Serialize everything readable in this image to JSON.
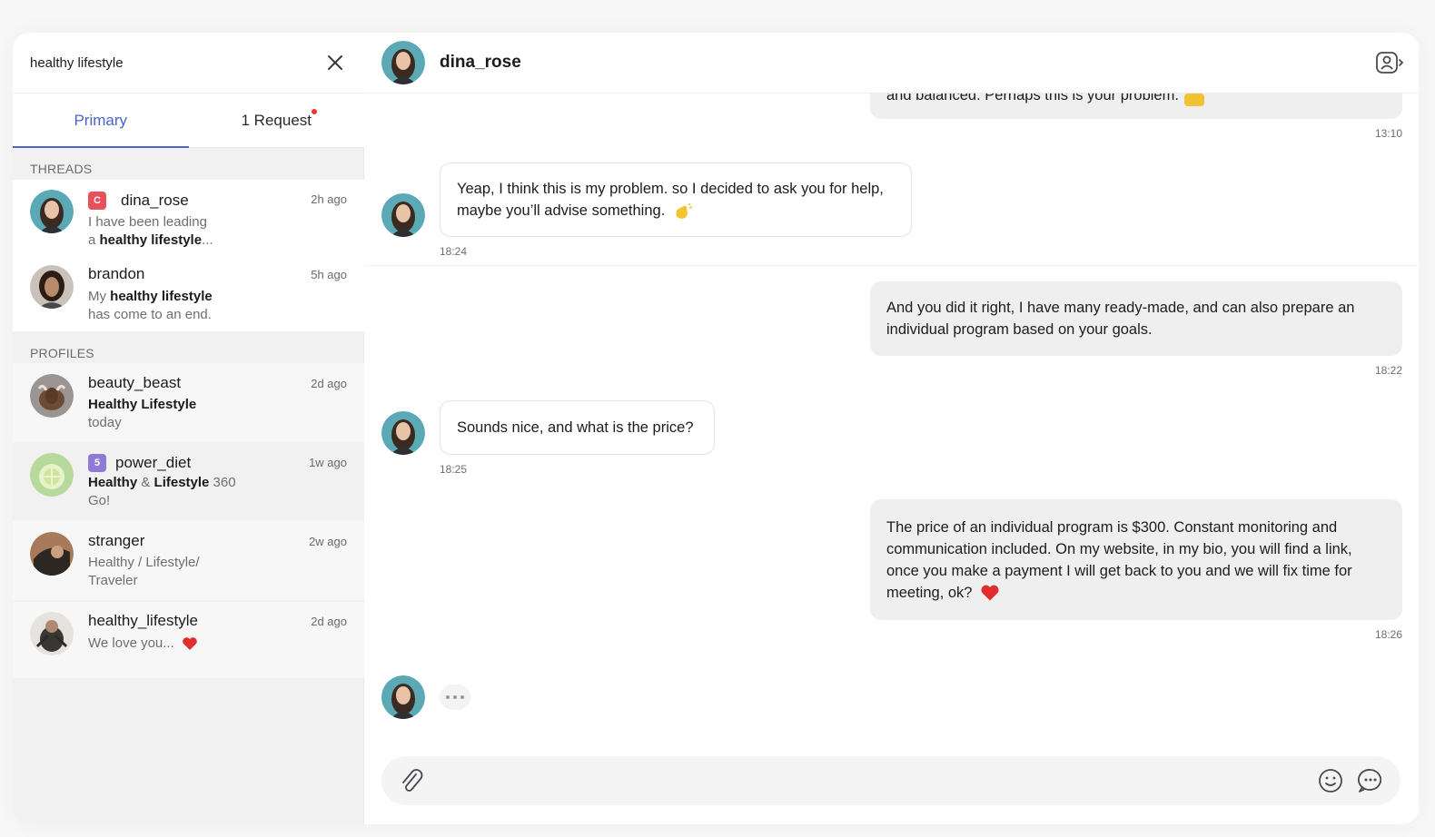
{
  "search": {
    "value": "healthy lifestyle",
    "placeholder": ""
  },
  "tabs": [
    {
      "label": "Primary",
      "active": true
    },
    {
      "label": "1 Request",
      "has_dot": true
    }
  ],
  "sections": {
    "threads": "THREADS",
    "profiles": "PROFILES"
  },
  "threads": [
    {
      "name": "dina_rose",
      "badge": "C",
      "badge_color": "#e8505b",
      "time": "2h ago",
      "line1": "I have been leading",
      "line2_pre": "a ",
      "line2_bold": "healthy lifestyle",
      "line2_post": "..."
    },
    {
      "name": "brandon",
      "time": "5h ago",
      "line1_pre": "My ",
      "line1_bold": "healthy lifestyle",
      "line2": "has come to an end."
    }
  ],
  "profiles": [
    {
      "name": "beauty_beast",
      "time": "2d ago",
      "line1_bold": "Healthy Lifestyle",
      "line2": "today"
    },
    {
      "name": "power_diet",
      "badge": "5",
      "badge_color": "#8f7bd6",
      "time": "1w ago",
      "line1_bold_a": "Healthy",
      "line1_mid": " & ",
      "line1_bold_b": "Lifestyle",
      "line1_post": " 360",
      "line2": "Go!"
    },
    {
      "name": "stranger",
      "time": "2w ago",
      "line1": "Healthy / Lifestyle/",
      "line2": "Traveler"
    },
    {
      "name": "healthy_lifestyle",
      "time": "2d ago",
      "line1": "We love you...",
      "icon": "heart-icon"
    }
  ],
  "chat": {
    "contact_name": "dina_rose",
    "partial_message": "and balanced. Perhaps this is your problem.",
    "partial_time": "13:10",
    "messages": [
      {
        "dir": "in",
        "text1": "Yeap, I think this is my problem. so I decided to ask you for help,",
        "text2": "maybe you’ll advise something.",
        "emoji": "waving-hand-icon",
        "time": "18:24"
      },
      {
        "dir": "out",
        "text1": "And you did it right, I have many ready-made, and can also prepare an",
        "text2": "individual program based on your goals.",
        "time": "18:22"
      },
      {
        "dir": "in",
        "text1": "Sounds nice, and what is the price?",
        "time": "18:25"
      },
      {
        "dir": "out",
        "text1": "The price of an individual program is $300. Constant monitoring and",
        "text2": "communication included. On my website, in my bio, you will find a link,",
        "text3": "once you make a payment I will get back to you and we will fix time for",
        "text4": "meeting, ok?",
        "emoji": "heart-icon",
        "time": "18:26"
      }
    ],
    "composer_placeholder": ""
  },
  "colors": {
    "accent": "#4b63c9",
    "heart": "#e02d2d",
    "outgoing_bubble": "#efeff0",
    "request_dot": "#e53935"
  }
}
